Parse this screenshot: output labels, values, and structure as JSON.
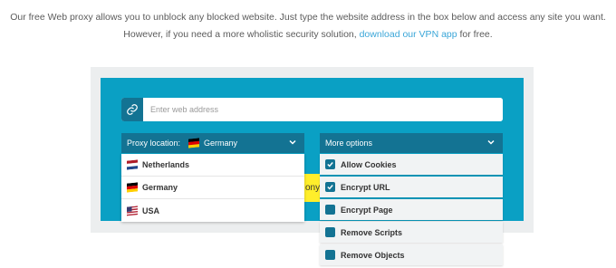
{
  "intro": {
    "text_before": "Our free Web proxy allows you to unblock any blocked website. Just type the website address in the box below and access any site you want. However, if you need a more wholistic security solution,",
    "link": "download our VPN app",
    "text_after": " for free."
  },
  "proxy_form": {
    "url_placeholder": "Enter web address",
    "link_icon": "link-icon",
    "location_label": "Proxy location:",
    "location_selected": "Germany",
    "more_options_label": "More options",
    "submit_peek_text": "ony",
    "locations": [
      {
        "label": "Netherlands",
        "flag": "netherlands-flag"
      },
      {
        "label": "Germany",
        "flag": "germany-flag"
      },
      {
        "label": "USA",
        "flag": "usa-flag"
      }
    ],
    "options": [
      {
        "label": "Allow Cookies",
        "checked": true
      },
      {
        "label": "Encrypt URL",
        "checked": true
      },
      {
        "label": "Encrypt Page",
        "checked": false
      },
      {
        "label": "Remove Scripts",
        "checked": false
      },
      {
        "label": "Remove Objects",
        "checked": false
      }
    ]
  },
  "colors": {
    "panel": "#0aa0c4",
    "dark_teal": "#137393",
    "link": "#3aa6d8",
    "submit_button": "#ffee2b"
  }
}
